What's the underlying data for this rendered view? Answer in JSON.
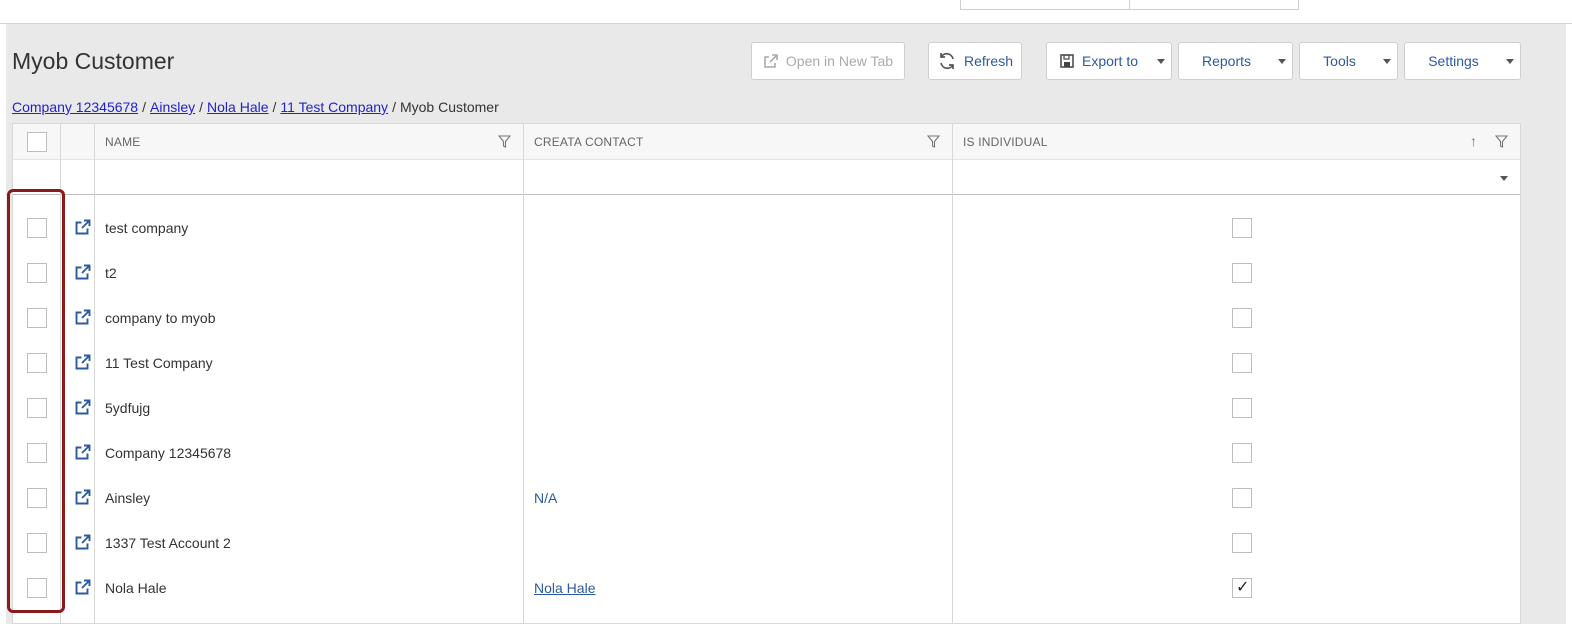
{
  "page": {
    "title": "Myob Customer"
  },
  "toolbar": {
    "open_new_tab_label": "Open in New Tab",
    "refresh_label": "Refresh",
    "export_label": "Export to",
    "reports_label": "Reports",
    "tools_label": "Tools",
    "settings_label": "Settings"
  },
  "breadcrumb": {
    "items": [
      "Company 12345678",
      "Ainsley",
      "Nola Hale",
      "11 Test Company"
    ],
    "current": "Myob Customer",
    "separator": "/"
  },
  "grid": {
    "columns": {
      "name": "NAME",
      "contact": "CREATA CONTACT",
      "individual": "IS INDIVIDUAL"
    },
    "sort_icon": "arrow-up-icon",
    "rows": [
      {
        "name": "test company",
        "contact": "",
        "is_individual": false
      },
      {
        "name": "t2",
        "contact": "",
        "is_individual": false
      },
      {
        "name": "company to myob",
        "contact": "",
        "is_individual": false
      },
      {
        "name": "11 Test Company",
        "contact": "",
        "is_individual": false
      },
      {
        "name": "5ydfujg",
        "contact": "",
        "is_individual": false
      },
      {
        "name": "Company 12345678",
        "contact": "",
        "is_individual": false
      },
      {
        "name": "Ainsley",
        "contact": "N/A",
        "is_individual": false
      },
      {
        "name": "1337 Test Account 2",
        "contact": "",
        "is_individual": false
      },
      {
        "name": "Nola Hale",
        "contact": "Nola Hale",
        "contact_is_link": true,
        "is_individual": true
      }
    ]
  },
  "colors": {
    "accent": "#2c5aa0",
    "highlight": "#8b1a1a",
    "link": "#2222cc",
    "panel": "#e9e9e9"
  }
}
